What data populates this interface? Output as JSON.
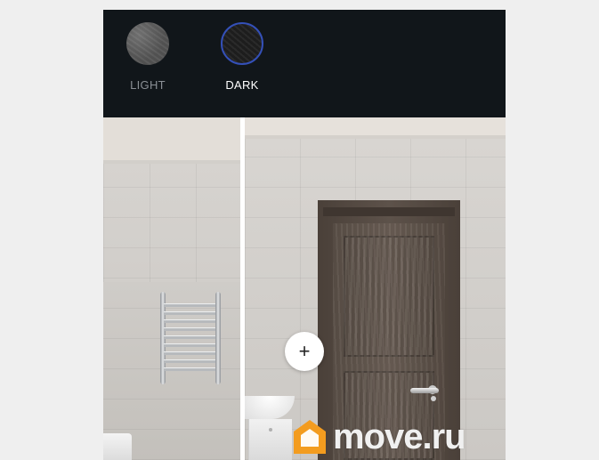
{
  "finish_selector": {
    "options": [
      {
        "label": "LIGHT",
        "selected": false
      },
      {
        "label": "DARK",
        "selected": true
      }
    ]
  },
  "comparison": {
    "toggle_icon": "plus-icon",
    "toggle_glyph": "+"
  },
  "watermark": {
    "text": "move.ru",
    "logo_icon": "house-logo-icon",
    "logo_color": "#f39c1f"
  },
  "colors": {
    "topbar": "#11161a",
    "selected_ring": "#3450b8"
  }
}
